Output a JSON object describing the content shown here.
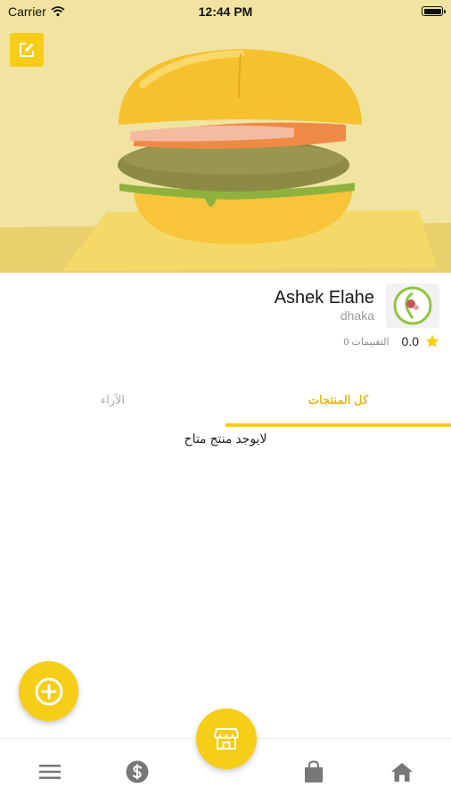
{
  "status_bar": {
    "carrier": "Carrier",
    "time": "12:44 PM"
  },
  "hero": {
    "image": "burger-image",
    "edit_icon": "edit-icon"
  },
  "store": {
    "name": "Ashek Elahe",
    "location": "dhaka",
    "rating_value": "0.0",
    "rating_count": "0 التقييمات",
    "logo_icon": "store-logo"
  },
  "tabs": {
    "products": "كل المنتجات",
    "reviews": "الآراء",
    "active": "products"
  },
  "main": {
    "empty_message": "لايوجد منتج متاح"
  },
  "fab": {
    "icon": "plus-circle-icon"
  },
  "bottom_nav": {
    "items": [
      "menu-icon",
      "dollar-icon",
      "store-icon",
      "bag-icon",
      "home-icon"
    ]
  },
  "colors": {
    "accent": "#f6cd17",
    "active_tab_text": "#e7b614",
    "inactive_tab_text": "#aaaaaa",
    "nav_icon": "#777777"
  }
}
